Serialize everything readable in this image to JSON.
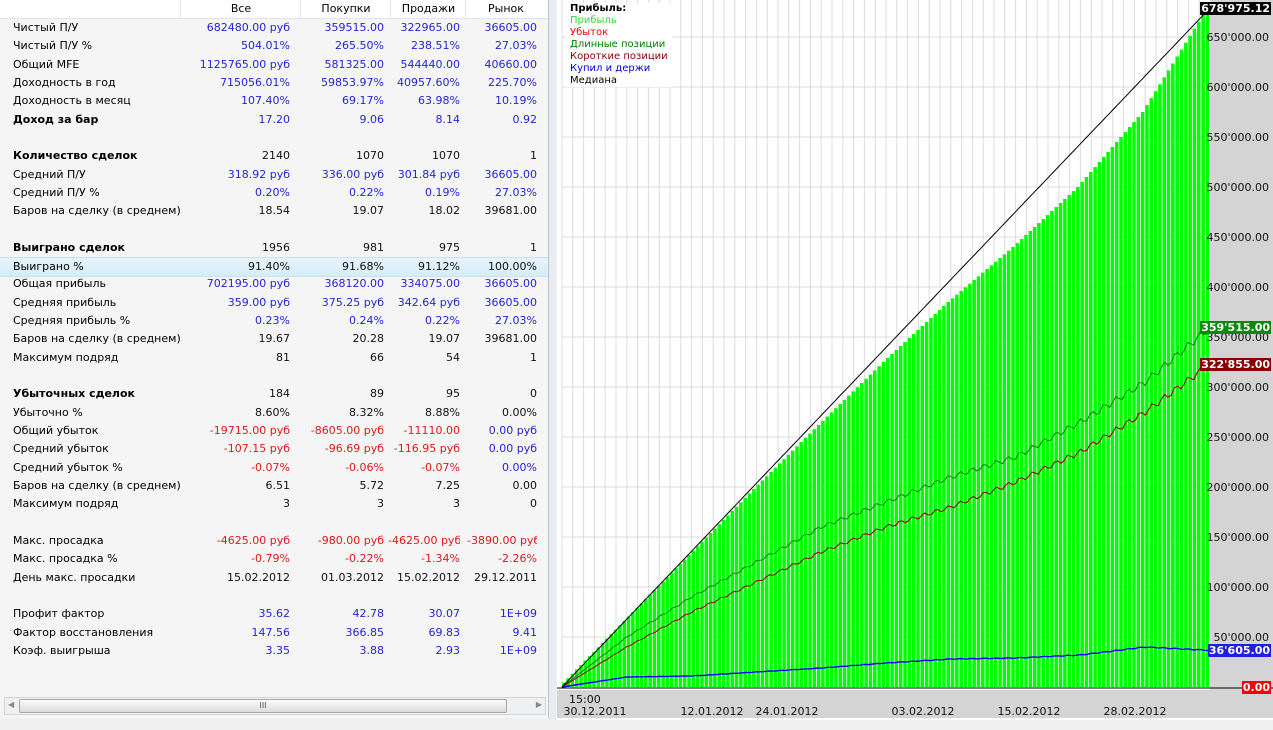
{
  "table": {
    "columns": [
      "Все",
      "Покупки",
      "Продажи",
      "Рынок"
    ],
    "rows": [
      {
        "label": "Чистый П/У",
        "values": [
          "682480.00 руб",
          "359515.00",
          "322965.00",
          "36605.00"
        ],
        "colors": [
          "b",
          "b",
          "b",
          "b"
        ]
      },
      {
        "label": "Чистый П/У %",
        "values": [
          "504.01%",
          "265.50%",
          "238.51%",
          "27.03%"
        ],
        "colors": [
          "b",
          "b",
          "b",
          "b"
        ]
      },
      {
        "label": "Общий MFE",
        "values": [
          "1125765.00 руб",
          "581325.00",
          "544440.00",
          "40660.00"
        ],
        "colors": [
          "b",
          "b",
          "b",
          "b"
        ]
      },
      {
        "label": "Доходность в год",
        "values": [
          "715056.01%",
          "59853.97%",
          "40957.60%",
          "225.70%"
        ],
        "colors": [
          "b",
          "b",
          "b",
          "b"
        ]
      },
      {
        "label": "Доходность в месяц",
        "values": [
          "107.40%",
          "69.17%",
          "63.98%",
          "10.19%"
        ],
        "colors": [
          "b",
          "b",
          "b",
          "b"
        ]
      },
      {
        "label": "Доход за бар",
        "bold": true,
        "values": [
          "17.20",
          "9.06",
          "8.14",
          "0.92"
        ],
        "colors": [
          "b",
          "b",
          "b",
          "b"
        ]
      },
      null,
      {
        "label": "Количество сделок",
        "bold": true,
        "values": [
          "2140",
          "1070",
          "1070",
          "1"
        ],
        "colors": [
          "k",
          "k",
          "k",
          "k"
        ]
      },
      {
        "label": "Средний П/У",
        "values": [
          "318.92 руб",
          "336.00 руб",
          "301.84 руб",
          "36605.00"
        ],
        "colors": [
          "b",
          "b",
          "b",
          "b"
        ]
      },
      {
        "label": "Средний П/У %",
        "values": [
          "0.20%",
          "0.22%",
          "0.19%",
          "27.03%"
        ],
        "colors": [
          "b",
          "b",
          "b",
          "b"
        ]
      },
      {
        "label": "Баров на сделку (в среднем)",
        "values": [
          "18.54",
          "19.07",
          "18.02",
          "39681.00"
        ],
        "colors": [
          "k",
          "k",
          "k",
          "k"
        ]
      },
      null,
      {
        "label": "Выиграно сделок",
        "bold": true,
        "values": [
          "1956",
          "981",
          "975",
          "1"
        ],
        "colors": [
          "k",
          "k",
          "k",
          "k"
        ]
      },
      {
        "label": "Выиграно %",
        "highlight": true,
        "values": [
          "91.40%",
          "91.68%",
          "91.12%",
          "100.00%"
        ],
        "colors": [
          "k",
          "k",
          "k",
          "k"
        ]
      },
      {
        "label": "Общая прибыль",
        "values": [
          "702195.00 руб",
          "368120.00",
          "334075.00",
          "36605.00"
        ],
        "colors": [
          "b",
          "b",
          "b",
          "b"
        ]
      },
      {
        "label": "Средняя прибыль",
        "values": [
          "359.00 руб",
          "375.25 руб",
          "342.64 руб",
          "36605.00"
        ],
        "colors": [
          "b",
          "b",
          "b",
          "b"
        ]
      },
      {
        "label": "Средняя прибыль %",
        "values": [
          "0.23%",
          "0.24%",
          "0.22%",
          "27.03%"
        ],
        "colors": [
          "b",
          "b",
          "b",
          "b"
        ]
      },
      {
        "label": "Баров на сделку (в среднем)",
        "values": [
          "19.67",
          "20.28",
          "19.07",
          "39681.00"
        ],
        "colors": [
          "k",
          "k",
          "k",
          "k"
        ]
      },
      {
        "label": "Максимум подряд",
        "values": [
          "81",
          "66",
          "54",
          "1"
        ],
        "colors": [
          "k",
          "k",
          "k",
          "k"
        ]
      },
      null,
      {
        "label": "Убыточных сделок",
        "bold": true,
        "values": [
          "184",
          "89",
          "95",
          "0"
        ],
        "colors": [
          "k",
          "k",
          "k",
          "k"
        ]
      },
      {
        "label": "Убыточно %",
        "values": [
          "8.60%",
          "8.32%",
          "8.88%",
          "0.00%"
        ],
        "colors": [
          "k",
          "k",
          "k",
          "k"
        ]
      },
      {
        "label": "Общий убыток",
        "values": [
          "-19715.00 руб",
          "-8605.00 руб",
          "-11110.00",
          "0.00 руб"
        ],
        "colors": [
          "r",
          "r",
          "r",
          "b"
        ]
      },
      {
        "label": "Средний убыток",
        "values": [
          "-107.15 руб",
          "-96.69 руб",
          "-116.95 руб",
          "0.00 руб"
        ],
        "colors": [
          "r",
          "r",
          "r",
          "b"
        ]
      },
      {
        "label": "Средний убыток %",
        "values": [
          "-0.07%",
          "-0.06%",
          "-0.07%",
          "0.00%"
        ],
        "colors": [
          "r",
          "r",
          "r",
          "b"
        ]
      },
      {
        "label": "Баров на сделку (в среднем)",
        "values": [
          "6.51",
          "5.72",
          "7.25",
          "0.00"
        ],
        "colors": [
          "k",
          "k",
          "k",
          "k"
        ]
      },
      {
        "label": "Максимум подряд",
        "values": [
          "3",
          "3",
          "3",
          "0"
        ],
        "colors": [
          "k",
          "k",
          "k",
          "k"
        ]
      },
      null,
      {
        "label": "Макс. просадка",
        "values": [
          "-4625.00 руб",
          "-980.00 руб",
          "-4625.00 руб",
          "-3890.00 руб"
        ],
        "colors": [
          "r",
          "r",
          "r",
          "r"
        ]
      },
      {
        "label": "Макс. просадка %",
        "values": [
          "-0.79%",
          "-0.22%",
          "-1.34%",
          "-2.26%"
        ],
        "colors": [
          "r",
          "r",
          "r",
          "r"
        ]
      },
      {
        "label": "День макс. просадки",
        "values": [
          "15.02.2012",
          "01.03.2012",
          "15.02.2012",
          "29.12.2011"
        ],
        "colors": [
          "k",
          "k",
          "k",
          "k"
        ]
      },
      null,
      {
        "label": "Профит фактор",
        "values": [
          "35.62",
          "42.78",
          "30.07",
          "1E+09"
        ],
        "colors": [
          "b",
          "b",
          "b",
          "b"
        ]
      },
      {
        "label": "Фактор восстановления",
        "values": [
          "147.56",
          "366.85",
          "69.83",
          "9.41"
        ],
        "colors": [
          "b",
          "b",
          "b",
          "b"
        ]
      },
      {
        "label": "Коэф. выигрыша",
        "values": [
          "3.35",
          "3.88",
          "2.93",
          "1E+09"
        ],
        "colors": [
          "b",
          "b",
          "b",
          "b"
        ]
      }
    ],
    "scroll_thumb": "III"
  },
  "chart_data": {
    "type": "bar+line",
    "legend": {
      "title": "Прибыль:",
      "placement": "top-left"
    },
    "x_tick_labels": [
      "30.12.2011",
      "12.01.2012",
      "24.01.2012",
      "03.02.2012",
      "15.02.2012",
      "28.02.2012"
    ],
    "x_time_label": "15:00",
    "ylim": [
      0,
      690000
    ],
    "y_ticks": [
      50000,
      100000,
      150000,
      200000,
      250000,
      300000,
      350000,
      400000,
      450000,
      500000,
      550000,
      600000,
      650000
    ],
    "y_tick_labels": [
      "50'000.00",
      "100'000.00",
      "150'000.00",
      "200'000.00",
      "250'000.00",
      "300'000.00",
      "350'000.00",
      "400'000.00",
      "450'000.00",
      "500'000.00",
      "550'000.00",
      "600'000.00",
      "650'000.00"
    ],
    "grid": true,
    "series": [
      {
        "name": "Прибыль",
        "kind": "bar",
        "color": "#00ff00",
        "values": [
          0,
          66000,
          132000,
          198000,
          262000,
          325000,
          385000,
          440000,
          500000,
          575000,
          678975
        ],
        "last_label": "678'975.12"
      },
      {
        "name": "Убыток",
        "kind": "bar",
        "color": "#ff0000",
        "values": [
          0,
          0,
          0,
          0,
          0,
          0,
          0,
          0,
          0,
          0,
          0
        ],
        "last_label": "0.00"
      },
      {
        "name": "Длинные позиции",
        "kind": "line",
        "color": "#008000",
        "values": [
          0,
          50000,
          90000,
          125000,
          160000,
          185000,
          210000,
          230000,
          265000,
          305000,
          359515
        ],
        "last_label": "359'515.00"
      },
      {
        "name": "Короткие позиции",
        "kind": "line",
        "color": "#8b0000",
        "values": [
          0,
          40000,
          75000,
          105000,
          135000,
          160000,
          180000,
          205000,
          235000,
          275000,
          322855
        ],
        "last_label": "322'855.00"
      },
      {
        "name": "Купил и держи",
        "kind": "line",
        "color": "#0000ff",
        "values": [
          0,
          10000,
          11000,
          15000,
          19000,
          24000,
          28000,
          29000,
          32000,
          40000,
          36605
        ],
        "last_label": "36'605.00"
      },
      {
        "name": "Медиана",
        "kind": "line",
        "color": "#000000",
        "values": [
          0,
          67898,
          135795,
          203693,
          271590,
          339488,
          407385,
          475283,
          543180,
          611078,
          678975
        ]
      }
    ]
  }
}
